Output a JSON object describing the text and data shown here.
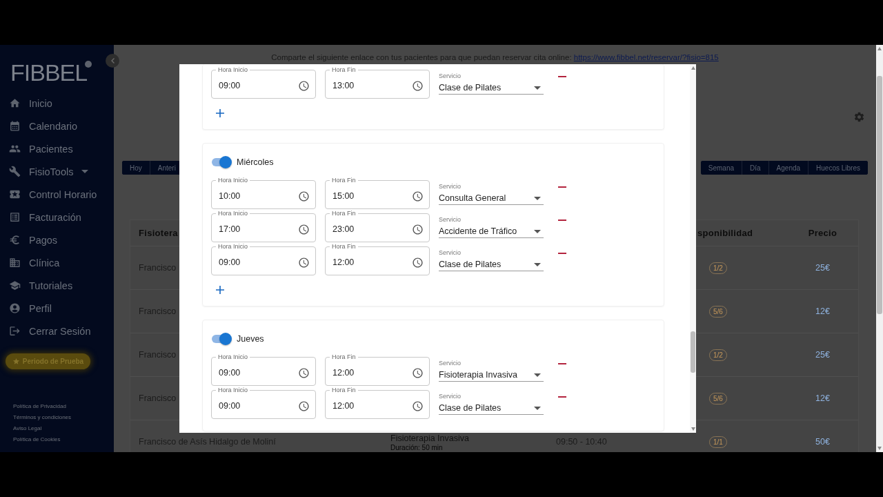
{
  "sidebar": {
    "logo": "FIBBEL",
    "items": [
      {
        "label": "Inicio",
        "kind": "link"
      },
      {
        "label": "Calendario",
        "kind": "link"
      },
      {
        "label": "Pacientes",
        "kind": "link"
      },
      {
        "label": "FisioTools",
        "kind": "submenu"
      },
      {
        "label": "Control Horario",
        "kind": "link"
      },
      {
        "label": "Facturación",
        "kind": "link"
      },
      {
        "label": "Pagos",
        "kind": "link"
      },
      {
        "label": "Clínica",
        "kind": "link"
      },
      {
        "label": "Tutoriales",
        "kind": "link"
      },
      {
        "label": "Perfil",
        "kind": "link"
      },
      {
        "label": "Cerrar Sesión",
        "kind": "link"
      }
    ],
    "trial_button": "Periodo de Prueba",
    "footer_links": [
      "Política de Privacidad",
      "Términos y condiciones",
      "Aviso Legal",
      "Política de Cookies"
    ]
  },
  "share": {
    "text": "Comparte el siguiente enlace con tus pacientes para que puedan reservar cita online:",
    "link": "https://www.fibbel.net/reservar/?fisio=815"
  },
  "toolbar": {
    "navigation": [
      "Hoy",
      "Anteri"
    ],
    "views": [
      "Semana",
      "Día",
      "Agenda",
      "Huecos Libres"
    ]
  },
  "table": {
    "header": {
      "column_1": "Fisiotera",
      "column_4": "sponibilidad",
      "column_5": "Precio"
    },
    "rows": [
      {
        "column_1": "Francisco",
        "availability": "1/2",
        "price": "25€"
      },
      {
        "column_1": "Francisco",
        "availability": "5/6",
        "price": "12€"
      },
      {
        "column_1": "Francisco",
        "availability": "1/2",
        "price": "25€"
      },
      {
        "column_1": "Francisco",
        "availability": "5/6",
        "price": "12€"
      },
      {
        "column_1": "Francisco de Asís Hidalgo de Moliní",
        "service": "Fisioterapia Invasiva",
        "duration": "Duración: 50 min",
        "time": "09:50 - 10:40",
        "availability": "1/1",
        "price": "50€"
      }
    ]
  },
  "modal": {
    "days": [
      {
        "add_button": true,
        "slots": [
          {
            "start_label": "Hora Inicio",
            "start": "09:00",
            "end_label": "Hora Fin",
            "end": "13:00",
            "service_label": "Servicio",
            "service": "Clase de Pilates"
          }
        ]
      },
      {
        "label": "Miércoles",
        "on": true,
        "add_button": true,
        "slots": [
          {
            "start_label": "Hora Inicio",
            "start": "10:00",
            "end_label": "Hora Fin",
            "end": "15:00",
            "service_label": "Servicio",
            "service": "Consulta General"
          },
          {
            "start_label": "Hora Inicio",
            "start": "17:00",
            "end_label": "Hora Fin",
            "end": "23:00",
            "service_label": "Servicio",
            "service": "Accidente de Tráfico"
          },
          {
            "start_label": "Hora Inicio",
            "start": "09:00",
            "end_label": "Hora Fin",
            "end": "12:00",
            "service_label": "Servicio",
            "service": "Clase de Pilates"
          }
        ]
      },
      {
        "label": "Jueves",
        "on": true,
        "slots": [
          {
            "start_label": "Hora Inicio",
            "start": "09:00",
            "end_label": "Hora Fin",
            "end": "12:00",
            "service_label": "Servicio",
            "service": "Fisioterapia Invasiva"
          },
          {
            "start_label": "Hora Inicio",
            "start": "09:00",
            "end_label": "Hora Fin",
            "end": "12:00",
            "service_label": "Servicio",
            "service": "Clase de Pilates"
          }
        ]
      }
    ]
  }
}
